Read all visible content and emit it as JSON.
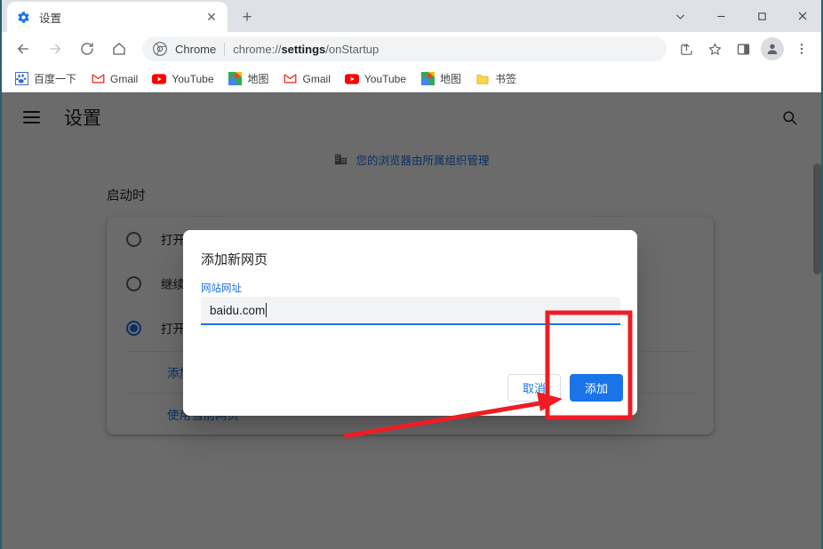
{
  "window": {
    "controls": {
      "tab_search": "⌄",
      "minimize": "—",
      "maximize": "▢",
      "close": "✕"
    }
  },
  "tabstrip": {
    "tabs": [
      {
        "title": "设置",
        "favicon": "gear-icon",
        "close": "✕"
      }
    ],
    "new_tab_label": "+"
  },
  "toolbar": {
    "back": "←",
    "forward": "→",
    "reload": "⟳",
    "home": "⌂",
    "omnibox": {
      "site_icon": "chrome-icon",
      "scheme_label": "Chrome",
      "url_prefix": "chrome://",
      "url_bold": "settings",
      "url_suffix": "/onStartup"
    },
    "share_icon": "share-icon",
    "bookmark_icon": "star-icon",
    "side_panel_icon": "side-panel-icon",
    "profile_icon": "avatar-icon",
    "menu_icon": "three-dot-menu-icon"
  },
  "bookmarks": {
    "items": [
      {
        "label": "百度一下",
        "icon": "baidu-icon"
      },
      {
        "label": "Gmail",
        "icon": "gmail-icon"
      },
      {
        "label": "YouTube",
        "icon": "youtube-icon"
      },
      {
        "label": "地图",
        "icon": "maps-icon"
      },
      {
        "label": "Gmail",
        "icon": "gmail-icon"
      },
      {
        "label": "YouTube",
        "icon": "youtube-icon"
      },
      {
        "label": "地图",
        "icon": "maps-icon"
      },
      {
        "label": "书签",
        "icon": "folder-icon"
      }
    ]
  },
  "settings": {
    "menu_icon": "hamburger-icon",
    "title": "设置",
    "search_icon": "search-icon",
    "managed_notice": {
      "icon": "building-icon",
      "text": "您的浏览器由所属组织管理"
    },
    "section_label": "启动时",
    "options": [
      {
        "label": "打开新标签页",
        "selected": false
      },
      {
        "label": "继续浏览上次打开的网页",
        "selected": false
      },
      {
        "label": "打开特定网页或一组网页",
        "selected": true
      }
    ],
    "links": [
      {
        "label": "添加新网页"
      },
      {
        "label": "使用当前网页"
      }
    ]
  },
  "dialog": {
    "title": "添加新网页",
    "field_label": "网站网址",
    "input_value": "baidu.com",
    "input_placeholder": "网站网址",
    "cancel_label": "取消",
    "confirm_label": "添加"
  },
  "annotation": {
    "color": "#ee1c24",
    "shape": "highlight-rectangle-with-arrow"
  },
  "colors": {
    "accent_blue": "#1a73e8",
    "chrome_frame": "#dee1e6",
    "annotation_red": "#ee1c24",
    "text_primary": "#202124",
    "text_secondary": "#5f6368"
  }
}
